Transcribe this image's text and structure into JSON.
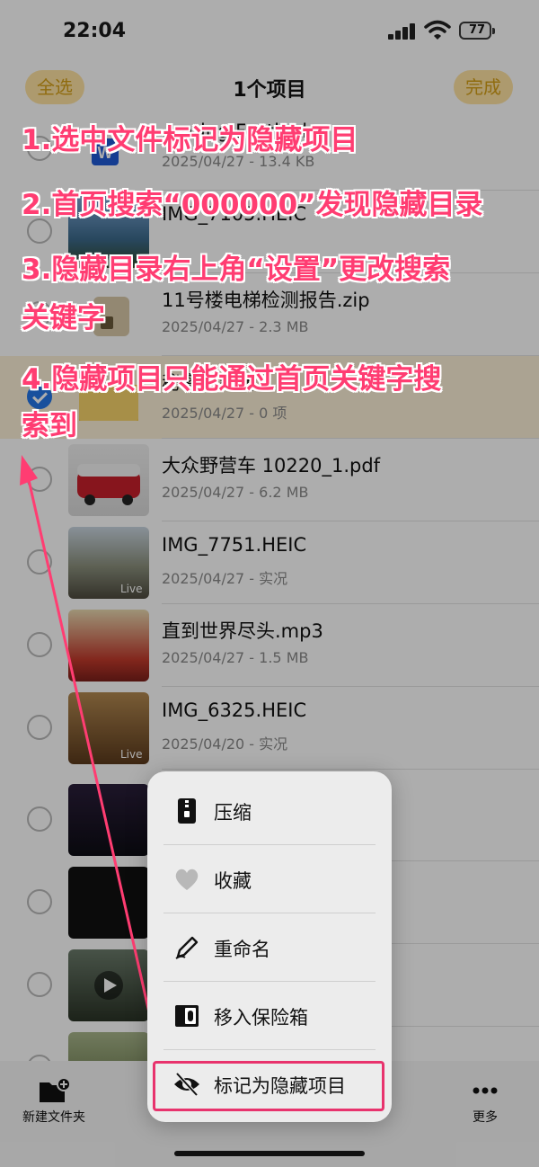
{
  "status_bar": {
    "time": "22:04",
    "battery": "77"
  },
  "nav": {
    "select_all": "全选",
    "title": "1个项目",
    "done": "完成"
  },
  "files": [
    {
      "name": "…pring Festival…",
      "meta": "2025/04/27 - 13.4 KB",
      "thumb": "word-icon",
      "selected": false
    },
    {
      "name": "IMG_7105.HEIC",
      "meta": "",
      "thumb": "photo",
      "selected": false
    },
    {
      "name": "11号楼电梯检测报告.zip",
      "meta": "2025/04/27 - 2.3 MB",
      "thumb": "zip-icon",
      "selected": false
    },
    {
      "name": "秘密研究所",
      "meta": "2025/04/27 - 0 项",
      "thumb": "folder-icon",
      "selected": true
    },
    {
      "name": "大众野营车 10220_1.pdf",
      "meta": "2025/04/27 - 6.2 MB",
      "thumb": "pdf-preview",
      "selected": false
    },
    {
      "name": "IMG_7751.HEIC",
      "meta": "2025/04/27 - 实况",
      "thumb": "photo",
      "live": "Live",
      "selected": false
    },
    {
      "name": "直到世界尽头.mp3",
      "meta": "2025/04/27 - 1.5 MB",
      "thumb": "album-art",
      "selected": false
    },
    {
      "name": "IMG_6325.HEIC",
      "meta": "2025/04/20 - 实况",
      "thumb": "photo",
      "live": "Live",
      "selected": false
    },
    {
      "name": "",
      "meta": "",
      "thumb": "video",
      "selected": false
    },
    {
      "name": "",
      "meta": "",
      "thumb": "video",
      "selected": false
    },
    {
      "name": "",
      "meta": "",
      "thumb": "video",
      "selected": false
    },
    {
      "name": "",
      "meta": "",
      "thumb": "photo",
      "selected": false
    }
  ],
  "toolbar": {
    "new_folder": "新建文件夹",
    "more": "更多"
  },
  "context_menu": {
    "items": [
      {
        "label": "压缩",
        "icon": "zip-icon"
      },
      {
        "label": "收藏",
        "icon": "heart-icon"
      },
      {
        "label": "重命名",
        "icon": "pencil-icon"
      },
      {
        "label": "移入保险箱",
        "icon": "safe-icon"
      },
      {
        "label": "标记为隐藏项目",
        "icon": "eye-slash-icon"
      }
    ]
  },
  "annotations": [
    "1.选中文件标记为隐藏项目",
    "2.首页搜索“000000”发现隐藏目录",
    "3.隐藏目录右上角“设置”更改搜索",
    "关键字",
    "4.隐藏项目只能通过首页关键字搜",
    "索到"
  ],
  "colors": {
    "accent": "#d4a017",
    "annotation": "#ff3d72",
    "check": "#2476e8"
  }
}
